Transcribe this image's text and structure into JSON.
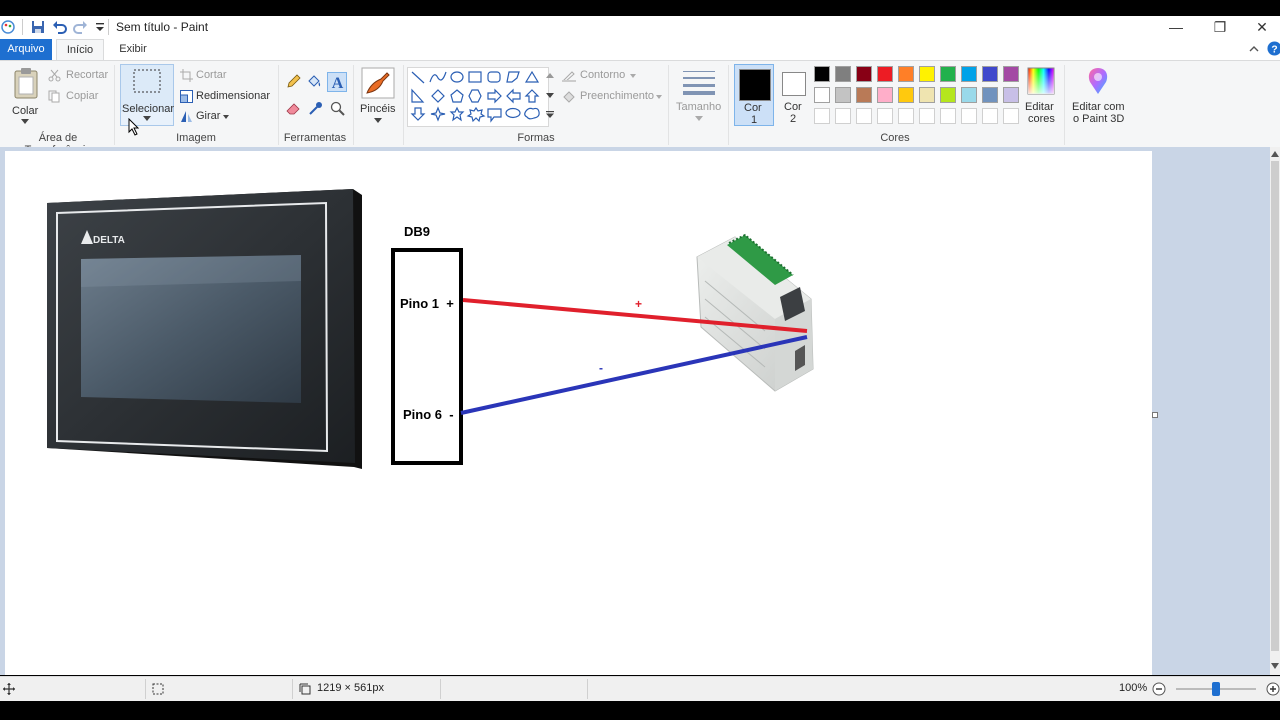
{
  "window": {
    "title": "Sem título - Paint"
  },
  "tabs": {
    "arquivo": "Arquivo",
    "inicio": "Início",
    "exibir": "Exibir"
  },
  "clipboard": {
    "colar": "Colar",
    "recortar": "Recortar",
    "copiar": "Copiar",
    "group_label": "Área de Transferência"
  },
  "image": {
    "selecionar": "Selecionar",
    "cortar": "Cortar",
    "redimensionar": "Redimensionar",
    "girar": "Girar",
    "group_label": "Imagem"
  },
  "tools": {
    "group_label": "Ferramentas"
  },
  "brushes": {
    "label": "Pincéis"
  },
  "shapes": {
    "contorno": "Contorno",
    "preenchimento": "Preenchimento",
    "group_label": "Formas"
  },
  "size": {
    "label": "Tamanho"
  },
  "colors": {
    "cor1_line1": "Cor",
    "cor1_line2": "1",
    "cor2_line1": "Cor",
    "cor2_line2": "2",
    "group_label": "Cores",
    "editar_line1": "Editar",
    "editar_line2": "cores",
    "paint3d_line1": "Editar com",
    "paint3d_line2": "o Paint 3D",
    "row1": [
      "#000000",
      "#7f7f7f",
      "#880015",
      "#ed1c24",
      "#ff7f27",
      "#fff200",
      "#22b14c",
      "#00a2e8",
      "#3f48cc",
      "#a349a4"
    ],
    "row2": [
      "#ffffff",
      "#c3c3c3",
      "#b97a57",
      "#ffaec9",
      "#ffc90e",
      "#efe4b0",
      "#b5e61d",
      "#99d9ea",
      "#7092be",
      "#c8bfe7"
    ]
  },
  "drawing": {
    "db9_label": "DB9",
    "pin1_label": "Pino 1  +",
    "pin6_label": "Pino 6  -",
    "plus_mark": "+",
    "minus_mark": "-",
    "hmi_brand": "DELTA",
    "red_wire": "#e0202c",
    "blue_wire": "#2a35b8"
  },
  "status": {
    "dimensions": "1219 × 561px",
    "zoom": "100%"
  }
}
